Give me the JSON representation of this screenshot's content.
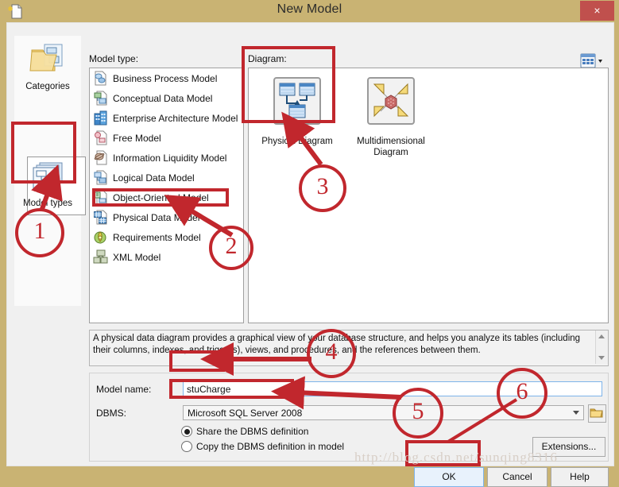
{
  "window": {
    "title": "New Model",
    "title_icon": "new-document-icon",
    "close_label": "×"
  },
  "labels": {
    "model_type": "Model type:",
    "diagram": "Diagram:"
  },
  "categories_bar": {
    "items": [
      {
        "label": "Categories",
        "icon": "categories-folder-icon",
        "selected": false
      },
      {
        "label": "Model types",
        "icon": "model-types-stack-icon",
        "selected": true
      }
    ]
  },
  "model_types": {
    "selected": "Physical Data Model",
    "items": [
      {
        "label": "Business Process Model",
        "icon": "business-process-icon"
      },
      {
        "label": "Conceptual Data Model",
        "icon": "conceptual-data-icon"
      },
      {
        "label": "Enterprise Architecture Model",
        "icon": "enterprise-architecture-icon"
      },
      {
        "label": "Free Model",
        "icon": "free-model-icon"
      },
      {
        "label": "Information Liquidity Model",
        "icon": "information-liquidity-icon"
      },
      {
        "label": "Logical Data Model",
        "icon": "logical-data-icon"
      },
      {
        "label": "Object-Oriented Model",
        "icon": "object-oriented-icon"
      },
      {
        "label": "Physical Data Model",
        "icon": "physical-data-icon"
      },
      {
        "label": "Requirements Model",
        "icon": "requirements-icon"
      },
      {
        "label": "XML Model",
        "icon": "xml-model-icon"
      }
    ]
  },
  "diagrams": {
    "view_mode_icon": "view-list-icon",
    "selected": "Physical Diagram",
    "items": [
      {
        "label": "Physical Diagram",
        "icon": "physical-diagram-icon"
      },
      {
        "label": "Multidimensional Diagram",
        "icon": "multidimensional-diagram-icon"
      }
    ]
  },
  "description": {
    "text": "A physical data diagram provides a graphical view of your database structure, and helps you analyze its tables (including their columns, indexes, and triggers), views, and procedures, and the references between them."
  },
  "form": {
    "model_name_label": "Model name:",
    "model_name_value": "stuCharge",
    "model_name_placeholder": "",
    "dbms_label": "DBMS:",
    "dbms_value": "Microsoft SQL Server 2008",
    "dbms_options": [
      "Microsoft SQL Server 2008"
    ],
    "browse_icon": "folder-icon",
    "radio_share": "Share the DBMS definition",
    "radio_copy": "Copy the DBMS definition in model",
    "radio_selected": "share",
    "extensions_button": "Extensions..."
  },
  "buttons": {
    "ok": "OK",
    "cancel": "Cancel",
    "help": "Help"
  },
  "annotations": {
    "numbers": [
      "1",
      "2",
      "3",
      "4",
      "5",
      "6"
    ],
    "color": "#c1272d"
  },
  "watermark": {
    "text": "http://blog.csdn.net/sunqing8316"
  }
}
